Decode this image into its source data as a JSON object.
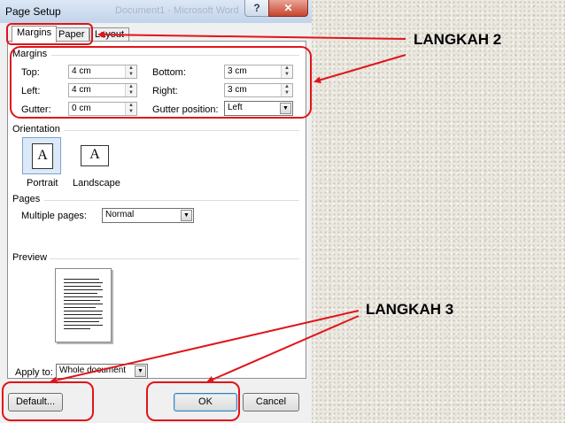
{
  "dialog": {
    "title": "Page Setup",
    "ghost_title": "Document1 - Microsoft Word",
    "help_label": "?",
    "close_label": "✕"
  },
  "tabs": [
    {
      "label": "Margins",
      "active": true
    },
    {
      "label": "Paper",
      "active": false
    },
    {
      "label": "Layout",
      "active": false
    }
  ],
  "margins": {
    "group_label": "Margins",
    "top": {
      "label": "Top:",
      "value": "4 cm"
    },
    "bottom": {
      "label": "Bottom:",
      "value": "3 cm"
    },
    "left": {
      "label": "Left:",
      "value": "4 cm"
    },
    "right": {
      "label": "Right:",
      "value": "3 cm"
    },
    "gutter": {
      "label": "Gutter:",
      "value": "0 cm"
    },
    "gutter_position": {
      "label": "Gutter position:",
      "value": "Left"
    }
  },
  "orientation": {
    "group_label": "Orientation",
    "glyph": "A",
    "portrait_label": "Portrait",
    "landscape_label": "Landscape",
    "selected": "portrait"
  },
  "pages": {
    "group_label": "Pages",
    "multiple_pages_label": "Multiple pages:",
    "multiple_pages_value": "Normal"
  },
  "preview": {
    "group_label": "Preview"
  },
  "apply_to": {
    "label": "Apply to:",
    "value": "Whole document"
  },
  "buttons": {
    "default": "Default...",
    "ok": "OK",
    "cancel": "Cancel"
  },
  "annotations": {
    "step2": "LANGKAH 2",
    "step3": "LANGKAH 3"
  },
  "colors": {
    "highlight": "#e0151b",
    "dialog_bg": "#f0f0f0",
    "panel_bg": "#ffffff",
    "selected_bg": "#dce9f8"
  },
  "icons": {
    "spin_up": "▲",
    "spin_down": "▼",
    "dropdown": "▼",
    "spinner": "spinner-icon",
    "dropdown_name": "dropdown-arrow-icon",
    "orientation": "page-orientation-icon"
  }
}
